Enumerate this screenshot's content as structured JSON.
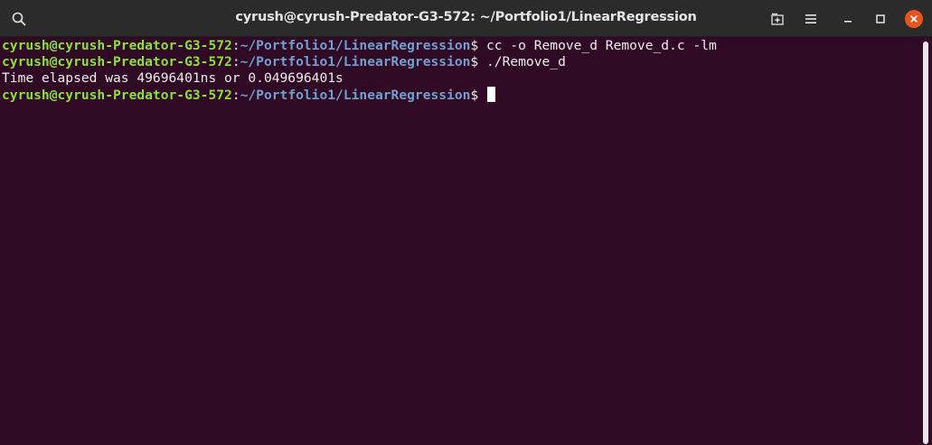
{
  "window": {
    "title": "cyrush@cyrush-Predator-G3-572: ~/Portfolio1/LinearRegression"
  },
  "titlebar": {
    "icons": {
      "search": "search-icon",
      "new_tab": "new-tab-icon",
      "menu": "hamburger-menu-icon",
      "minimize": "minimize-icon",
      "maximize": "maximize-icon",
      "close": "close-icon"
    },
    "close_color": "#e9541d"
  },
  "terminal": {
    "colors": {
      "background": "#300a24",
      "user_host": "#8ae234",
      "path": "#729fcf",
      "text": "#eeeeec"
    },
    "lines": [
      {
        "user_host": "cyrush@cyrush-Predator-G3-572",
        "separator": ":",
        "path": "~/Portfolio1/LinearRegression",
        "prompt": "$ ",
        "command": "cc -o Remove_d Remove_d.c -lm"
      },
      {
        "user_host": "cyrush@cyrush-Predator-G3-572",
        "separator": ":",
        "path": "~/Portfolio1/LinearRegression",
        "prompt": "$ ",
        "command": "./Remove_d"
      },
      {
        "output": "Time elapsed was 49696401ns or 0.049696401s"
      },
      {
        "user_host": "cyrush@cyrush-Predator-G3-572",
        "separator": ":",
        "path": "~/Portfolio1/LinearRegression",
        "prompt": "$ ",
        "command": ""
      }
    ]
  }
}
